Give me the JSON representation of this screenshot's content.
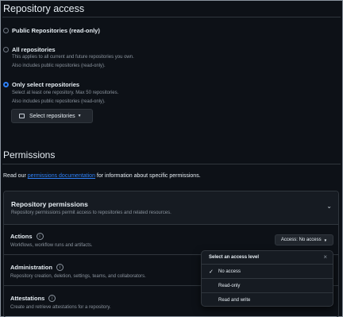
{
  "repo_access": {
    "title": "Repository access",
    "options": [
      {
        "label": "Public Repositories (read-only)",
        "selected": false,
        "desc": []
      },
      {
        "label": "All repositories",
        "selected": false,
        "desc": [
          "This applies to all current and future repositories you own.",
          "Also includes public repositories (read-only)."
        ]
      },
      {
        "label": "Only select repositories",
        "selected": true,
        "desc": [
          "Select at least one repository. Max 50 repositories.",
          "Also includes public repositories (read-only)."
        ]
      }
    ],
    "select_button": "Select repositories",
    "select_icon": "repo-icon"
  },
  "permissions": {
    "title": "Permissions",
    "read_prefix": "Read our ",
    "read_link": "permissions documentation",
    "read_suffix": " for information about specific permissions.",
    "repo_perms": {
      "title": "Repository permissions",
      "desc": "Repository permissions permit access to repositories and related resources."
    },
    "items": [
      {
        "name": "Actions",
        "desc": "Workflows, workflow runs and artifacts."
      },
      {
        "name": "Administration",
        "desc": "Repository creation, deletion, settings, teams, and collaborators."
      },
      {
        "name": "Attestations",
        "desc": "Create and retrieve attestations for a repository."
      }
    ],
    "access_button": "Access: No access"
  },
  "access_menu": {
    "title": "Select an access level",
    "options": [
      {
        "label": "No access",
        "checked": true
      },
      {
        "label": "Read-only",
        "checked": false
      },
      {
        "label": "Read and write",
        "checked": false
      }
    ]
  },
  "colors": {
    "background": "#0d1117",
    "accent": "#2f81f7",
    "border": "#30363d",
    "muted": "#8b949e"
  }
}
